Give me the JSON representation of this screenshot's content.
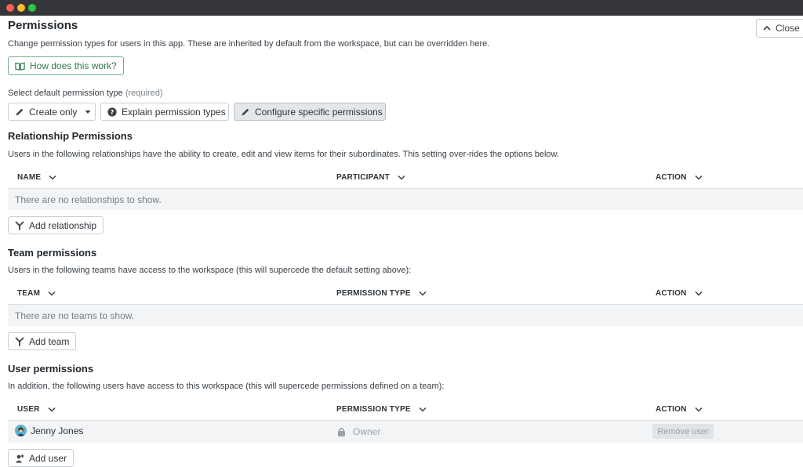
{
  "header": {
    "title": "Permissions",
    "subtitle": "Change permission types for users in this app. These are inherited by default from the workspace, but can be overridden here.",
    "close_label": "Close",
    "howto_label": "How does this work?"
  },
  "default_type": {
    "label": "Select default permission type",
    "required": "(required)",
    "create_only": "Create only",
    "explain": "Explain permission types",
    "configure": "Configure specific permissions"
  },
  "relationships": {
    "title": "Relationship Permissions",
    "desc": "Users in the following relationships have the ability to create, edit and view items for their subordinates. This setting over-rides the options below.",
    "columns": [
      "NAME",
      "PARTICIPANT",
      "ACTION"
    ],
    "empty": "There are no relationships to show.",
    "add_label": "Add relationship"
  },
  "teams": {
    "title": "Team permissions",
    "desc": "Users in the following teams have access to the workspace (this will supercede the default setting above):",
    "columns": [
      "TEAM",
      "PERMISSION TYPE",
      "ACTION"
    ],
    "empty": "There are no teams to show.",
    "add_label": "Add team"
  },
  "users": {
    "title": "User permissions",
    "desc": "In addition, the following users have access to this workspace (this will supercede permissions defined on a team):",
    "columns": [
      "USER",
      "PERMISSION TYPE",
      "ACTION"
    ],
    "rows": [
      {
        "name": "Jenny Jones",
        "permission": "Owner",
        "action": "Remove user"
      }
    ],
    "add_label": "Add user"
  },
  "colors": {
    "accent_green": "#2f7a4d",
    "titlebar": "#333538",
    "row_bg": "#f2f4f5"
  }
}
